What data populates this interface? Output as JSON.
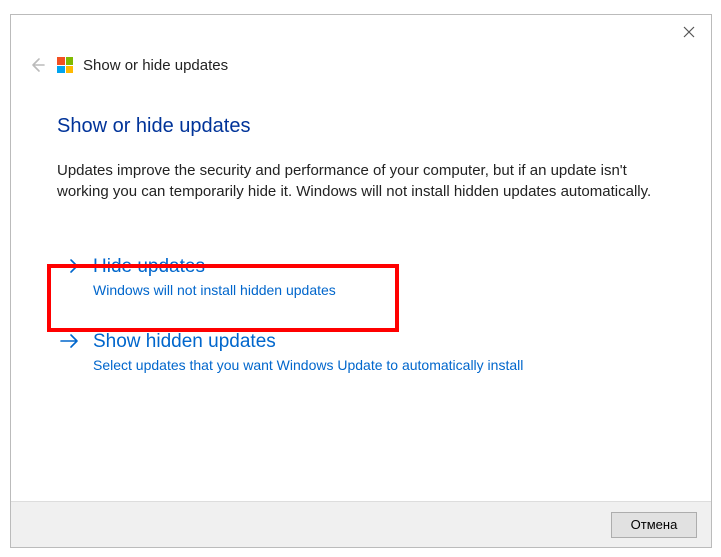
{
  "header": {
    "title": "Show or hide updates"
  },
  "page": {
    "title": "Show or hide updates",
    "description": "Updates improve the security and performance of your computer, but if an update isn't working you can temporarily hide it. Windows will not install hidden updates automatically."
  },
  "options": [
    {
      "title": "Hide updates",
      "description": "Windows will not install hidden updates"
    },
    {
      "title": "Show hidden updates",
      "description": "Select updates that you want Windows Update to automatically install"
    }
  ],
  "footer": {
    "cancel_label": "Отмена"
  }
}
